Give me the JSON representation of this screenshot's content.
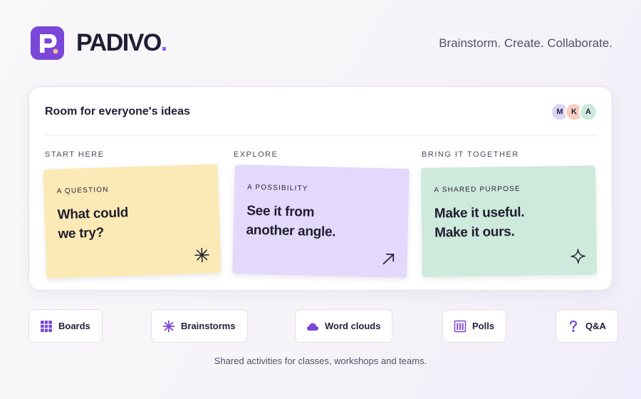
{
  "brand": {
    "name": "PADIVO",
    "dot": ".",
    "tagline": "Brainstorm. Create. Collaborate."
  },
  "colors": {
    "brand_purple": "#7a47d9",
    "accent_dot": "#8b5cf6",
    "note_yellow": "#fbeab5",
    "note_lavender": "#e2d9fc",
    "note_mint": "#cdeadd"
  },
  "card": {
    "title": "Room for everyone's ideas",
    "avatars": [
      "M",
      "K",
      "A"
    ],
    "columns": [
      {
        "label": "START HERE",
        "kicker": "A QUESTION",
        "text": "What could\nwe try?",
        "icon": "asterisk-icon"
      },
      {
        "label": "EXPLORE",
        "kicker": "A POSSIBILITY",
        "text": "See it from\nanother angle.",
        "icon": "arrow-up-right-icon"
      },
      {
        "label": "BRING IT TOGETHER",
        "kicker": "A SHARED PURPOSE",
        "text": "Make it useful.\nMake it ours.",
        "icon": "sparkle-icon"
      }
    ]
  },
  "activities": [
    {
      "label": "Boards",
      "icon": "grid-icon"
    },
    {
      "label": "Brainstorms",
      "icon": "asterisk-icon"
    },
    {
      "label": "Word clouds",
      "icon": "cloud-icon"
    },
    {
      "label": "Polls",
      "icon": "bar-chart-icon"
    },
    {
      "label": "Q&A",
      "icon": "question-mark-icon"
    }
  ],
  "footer": "Shared activities for classes, workshops and teams."
}
